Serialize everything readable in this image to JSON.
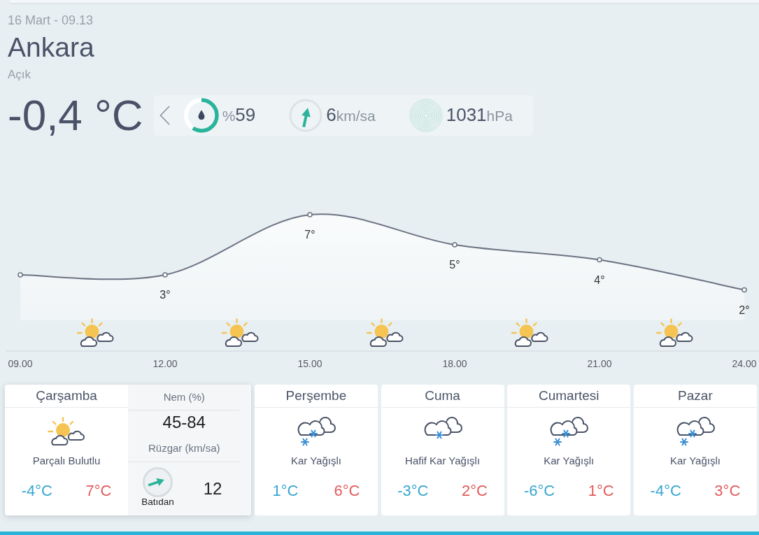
{
  "header": {
    "date_time": "16 Mart - 09.13",
    "city": "Ankara",
    "condition": "Açık",
    "temperature": "-0,4 °C"
  },
  "current_metrics": [
    {
      "kind": "humidity",
      "prefix": "%",
      "value": "59",
      "level": 0.59
    },
    {
      "kind": "wind",
      "value": "6",
      "unit": "km/sa"
    },
    {
      "kind": "pressure",
      "value": "1031",
      "unit": "hPa"
    }
  ],
  "hourly_forecast": {
    "chart_data": {
      "type": "area",
      "marker": true,
      "categories": [
        "09.00",
        "12.00",
        "15.00",
        "18.00",
        "21.00",
        "24.00"
      ],
      "values": [
        3,
        3,
        7,
        5,
        4,
        2
      ],
      "value_labels": [
        null,
        "3°",
        "7°",
        "5°",
        "4°",
        "2°"
      ]
    },
    "condition_icons": [
      {
        "kind": "partly-cloudy"
      },
      {
        "kind": "partly-cloudy"
      },
      {
        "kind": "partly-cloudy"
      },
      {
        "kind": "partly-cloudy"
      },
      {
        "kind": "partly-cloudy"
      }
    ]
  },
  "daily_forecast": [
    {
      "day": "Çarşamba",
      "kind": "partly-cloudy",
      "condition": "Parçalı Bulutlu",
      "low": "-4°C",
      "high": "7°C",
      "selected": true,
      "details": {
        "humidity_label": "Nem (%)",
        "humidity_range": "45-84",
        "wind_label": "Rüzgar (km/sa)",
        "wind_direction": "Batıdan",
        "wind_speed": "12"
      }
    },
    {
      "day": "Perşembe",
      "kind": "snow",
      "condition": "Kar Yağışlı",
      "low": "1°C",
      "high": "6°C",
      "selected": false
    },
    {
      "day": "Cuma",
      "kind": "light-snow",
      "condition": "Hafif Kar Yağışlı",
      "low": "-3°C",
      "high": "2°C",
      "selected": false
    },
    {
      "day": "Cumartesi",
      "kind": "snow",
      "condition": "Kar Yağışlı",
      "low": "-6°C",
      "high": "1°C",
      "selected": false
    },
    {
      "day": "Pazar",
      "kind": "snow",
      "condition": "Kar Yağışlı",
      "low": "-4°C",
      "high": "3°C",
      "selected": false
    }
  ]
}
